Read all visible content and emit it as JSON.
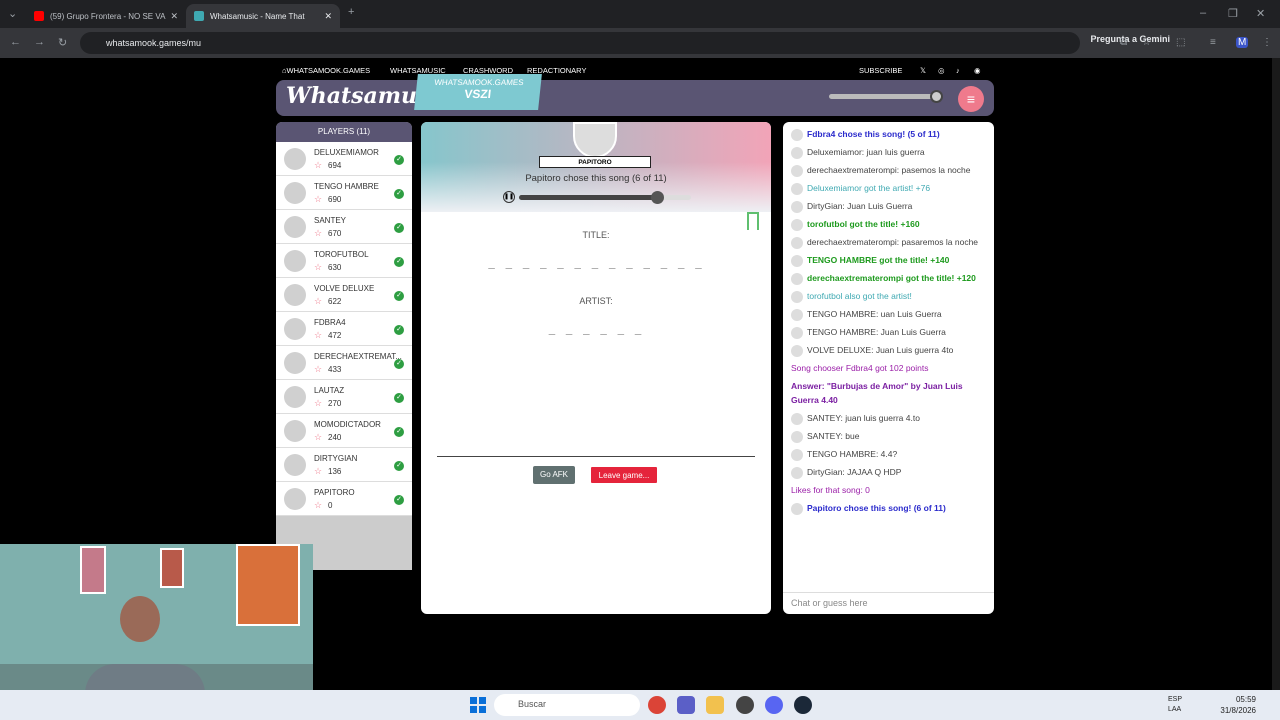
{
  "browser": {
    "tabs": [
      {
        "label": "(59) Grupo Frontera - NO SE VA",
        "active": false,
        "favicon_color": "#ff0000"
      },
      {
        "label": "Whatsamusic - Name That",
        "active": true,
        "favicon_color": "#3fa9b2"
      }
    ],
    "new_tab": "+",
    "url": "whatsamook.games/mu",
    "gemini_label": "Pregunta a Gemini"
  },
  "site_nav": {
    "home": "WHATSAMOOK.GAMES",
    "music": "WHATSAMUSIC",
    "crashword": "CRASHWORD",
    "redactionary": "REDACTIONARY",
    "subscribe": "SUBSCRIBE"
  },
  "header": {
    "logo": "Whatsamusic",
    "badge_top": "WHATSAMOOK.GAMES",
    "badge_code": "VSZI",
    "volume_fraction": 0.97
  },
  "players": {
    "title": "PLAYERS (11)",
    "list": [
      {
        "name": "DELUXEMIAMOR",
        "score": "694"
      },
      {
        "name": "TENGO HAMBRE",
        "score": "690"
      },
      {
        "name": "SANTEY",
        "score": "670"
      },
      {
        "name": "TOROFUTBOL",
        "score": "630"
      },
      {
        "name": "VOLVE DELUXE",
        "score": "622"
      },
      {
        "name": "FDBRA4",
        "score": "472"
      },
      {
        "name": "DERECHAEXTREMAT...",
        "score": "433"
      },
      {
        "name": "LAUTAZ",
        "score": "270"
      },
      {
        "name": "MOMODICTADOR",
        "score": "240"
      },
      {
        "name": "DIRTYGIAN",
        "score": "136"
      },
      {
        "name": "PAPITORO",
        "score": "0"
      }
    ]
  },
  "game": {
    "chooser": "PAPITORO",
    "chose_text": "Papitoro chose this song (6 of 11)",
    "progress_fraction": 0.8,
    "title_label": "TITLE:",
    "title_blanks": "_ _  _ _  _ _  _ _ _ _ _ _ _",
    "artist_label": "ARTIST:",
    "artist_blanks": "_ _ _ _  _ _",
    "afk_label": "Go AFK",
    "leave_label": "Leave game..."
  },
  "chat": {
    "messages": [
      {
        "style": "blue",
        "avatar": true,
        "text": "Fdbra4 chose this song! (5 of 11)"
      },
      {
        "style": "",
        "avatar": true,
        "text": "Deluxemiamor: juan luis guerra"
      },
      {
        "style": "",
        "avatar": true,
        "text": "derechaextrematerompi: pasemos la noche"
      },
      {
        "style": "teal",
        "avatar": true,
        "text": "Deluxemiamor got the artist! +76"
      },
      {
        "style": "",
        "avatar": true,
        "text": "DirtyGian: Juan Luis Guerra"
      },
      {
        "style": "green",
        "avatar": true,
        "text": "torofutbol got the title! +160"
      },
      {
        "style": "",
        "avatar": true,
        "text": "derechaextrematerompi: pasaremos la noche"
      },
      {
        "style": "green",
        "avatar": true,
        "text": "TENGO HAMBRE got the title! +140"
      },
      {
        "style": "green",
        "avatar": true,
        "text": "derechaextrematerompi got the title! +120"
      },
      {
        "style": "teal",
        "avatar": true,
        "text": "torofutbol also got the artist!"
      },
      {
        "style": "",
        "avatar": true,
        "text": "TENGO HAMBRE: uan Luis Guerra"
      },
      {
        "style": "",
        "avatar": true,
        "text": "TENGO HAMBRE: Juan Luis Guerra"
      },
      {
        "style": "",
        "avatar": true,
        "text": "VOLVE DELUXE: Juan Luis guerra 4to"
      },
      {
        "style": "purple",
        "avatar": false,
        "text": "Song chooser Fdbra4 got 102 points"
      },
      {
        "style": "purple-b",
        "avatar": false,
        "text": "Answer: \"Burbujas de Amor\" by Juan Luis Guerra 4.40"
      },
      {
        "style": "",
        "avatar": true,
        "text": "SANTEY: juan luis guerra 4.to"
      },
      {
        "style": "",
        "avatar": true,
        "text": "SANTEY: bue"
      },
      {
        "style": "",
        "avatar": true,
        "text": "TENGO HAMBRE: 4.4?"
      },
      {
        "style": "",
        "avatar": true,
        "text": "DirtyGian: JAJAA Q HDP"
      },
      {
        "style": "purple",
        "avatar": false,
        "text": "Likes for that song: 0"
      },
      {
        "style": "blue",
        "avatar": true,
        "text": "Papitoro chose this song! (6 of 11)"
      }
    ],
    "input_placeholder": "Chat or guess here"
  },
  "taskbar": {
    "search_placeholder": "Buscar",
    "lang_top": "ESP",
    "lang_bottom": "LAA",
    "time": "05:59",
    "date": "31/8/2026"
  }
}
